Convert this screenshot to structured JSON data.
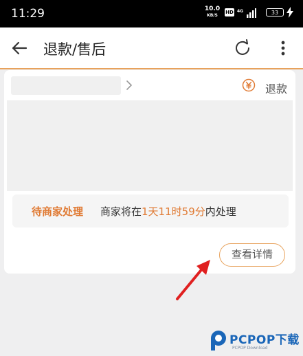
{
  "status_bar": {
    "time": "11:29",
    "speed_value": "10.0",
    "speed_unit": "KB/S",
    "hd_badge": "HD",
    "network": "4G",
    "battery": "33"
  },
  "app_bar": {
    "title": "退款/售后",
    "icons": [
      "back-arrow-icon",
      "refresh-icon",
      "more-vert-icon"
    ]
  },
  "order_card": {
    "refund_tag": "退款",
    "status_label": "待商家处理",
    "status_text_prefix": "商家将在",
    "status_countdown": "1天11时59分",
    "status_text_suffix": "内处理",
    "detail_button": "查看详情"
  },
  "watermark": {
    "brand": "PCPOP下载",
    "sub": "PCPOP Download"
  },
  "colors": {
    "accent": "#e07a33",
    "divider": "#e8a25c",
    "annotation_arrow": "#e02020"
  }
}
